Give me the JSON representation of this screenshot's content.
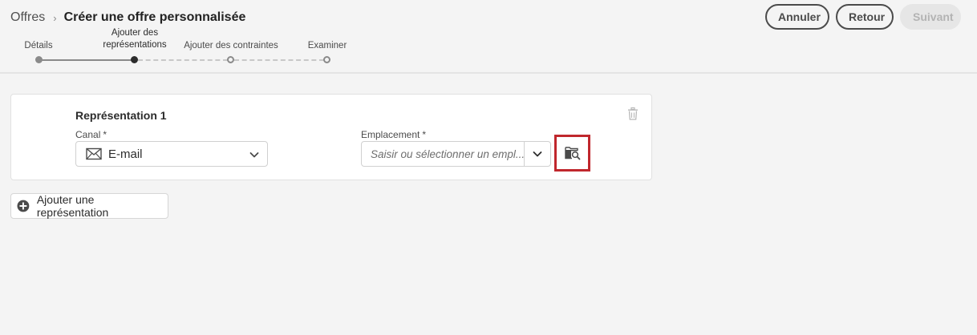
{
  "breadcrumb": {
    "root": "Offres",
    "separator": "›",
    "current": "Créer une offre personnalisée"
  },
  "actions": {
    "cancel": "Annuler",
    "back": "Retour",
    "next": "Suivant"
  },
  "stepper": {
    "steps": [
      {
        "line1": "Détails",
        "line2": "",
        "status": "done"
      },
      {
        "line1": "Ajouter des",
        "line2": "représentations",
        "status": "current"
      },
      {
        "line1": "Ajouter des contraintes",
        "line2": "",
        "status": "todo"
      },
      {
        "line1": "Examiner",
        "line2": "",
        "status": "todo"
      }
    ]
  },
  "representation": {
    "title": "Représentation 1",
    "channel": {
      "label": "Canal",
      "required_mark": "*",
      "value": "E-mail",
      "icon": "mail-icon"
    },
    "placement": {
      "label": "Emplacement",
      "required_mark": "*",
      "placeholder": "Saisir ou sélectionner un empl...",
      "value": ""
    }
  },
  "add_representation": {
    "label": "Ajouter une représentation",
    "icon": "add-circle-icon"
  },
  "colors": {
    "background": "#f4f4f4",
    "highlight": "#c0272d",
    "current_step": "#2c2c2c",
    "disabled_button": "#e6e6e6"
  }
}
